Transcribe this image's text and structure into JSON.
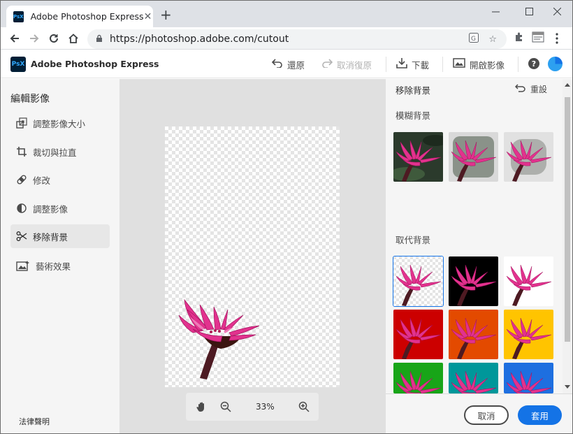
{
  "browser": {
    "tab_title": "Adobe Photoshop Express",
    "tab_favicon": "PsX",
    "url": "https://photoshop.adobe.com/cutout",
    "window_controls": [
      "minimize-icon",
      "maximize-icon",
      "close-icon"
    ]
  },
  "app": {
    "logo_text": "PsX",
    "name": "Adobe Photoshop Express",
    "actions": {
      "undo_label": "還原",
      "redo_label": "取消復原",
      "download_label": "下載",
      "open_label": "開啟影像",
      "help_label": "?"
    }
  },
  "sidebar": {
    "title": "編輯影像",
    "items": [
      {
        "label": "調整影像大小",
        "icon": "resize-icon"
      },
      {
        "label": "裁切與拉直",
        "icon": "crop-icon"
      },
      {
        "label": "修改",
        "icon": "bandage-icon"
      },
      {
        "label": "調整影像",
        "icon": "adjust-icon"
      },
      {
        "label": "移除背景",
        "icon": "scissors-icon",
        "active": true
      },
      {
        "label": "藝術效果",
        "icon": "art-effects-icon"
      }
    ],
    "legal_label": "法律聲明"
  },
  "canvas": {
    "zoom": "33%"
  },
  "panel": {
    "title": "移除背景",
    "reset_label": "重設",
    "blur_section_label": "模糊背景",
    "replace_section_label": "取代背景",
    "blur_options": [
      "dark-photo",
      "medium-blur",
      "strong-blur"
    ],
    "replace_colors": [
      "transparent",
      "#000000",
      "#ffffff",
      "#cc0000",
      "#e34a00",
      "#ffc400",
      "#18a518",
      "#00979a",
      "#1e6fe0"
    ],
    "selected_replace_index": 0,
    "cancel_label": "取消",
    "apply_label": "套用"
  },
  "colors": {
    "accent": "#1473e6",
    "flower_pink": "#e2328e"
  }
}
